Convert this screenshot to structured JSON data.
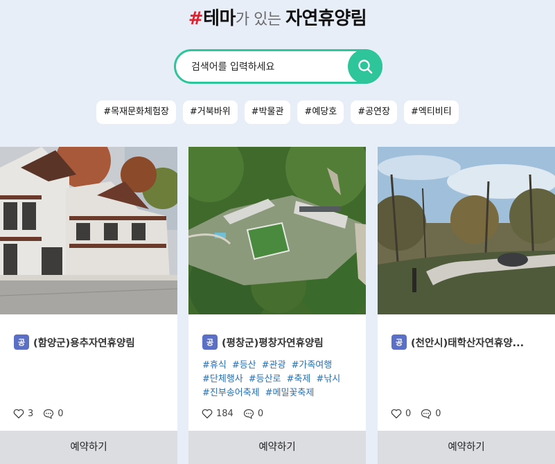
{
  "header": {
    "title_hash": "#",
    "title_part1": "테마",
    "title_part2": "가 있는 ",
    "title_part3": "자연휴양림"
  },
  "search": {
    "placeholder": "검색어를 입력하세요",
    "button_icon": "search-icon"
  },
  "tags": [
    "#목재문화체험장",
    "#거북바위",
    "#박물관",
    "#예당호",
    "#공연장",
    "#엑티비티"
  ],
  "cards": [
    {
      "badge": "공",
      "name": "(함양군)용추자연휴양림",
      "hashtags": [],
      "likes": "3",
      "comments": "0",
      "reserve_label": "예약하기"
    },
    {
      "badge": "공",
      "name": "(평창군)평창자연휴양림",
      "hashtags": [
        "#휴식",
        "#등산",
        "#관광",
        "#가족여행",
        "#단체행사",
        "#등산로",
        "#축제",
        "#낚시",
        "#진부송어축제",
        "#메밀꽃축제"
      ],
      "likes": "184",
      "comments": "0",
      "reserve_label": "예약하기"
    },
    {
      "badge": "공",
      "name": "(천안시)태학산자연휴양...",
      "hashtags": [],
      "likes": "0",
      "comments": "0",
      "reserve_label": "예약하기"
    }
  ],
  "colors": {
    "accent": "#2fc59a",
    "hash_red": "#e31e2d",
    "badge_blue": "#5b6fc7",
    "hashtag_blue": "#2a6fb0",
    "background": "#e8eef7"
  }
}
